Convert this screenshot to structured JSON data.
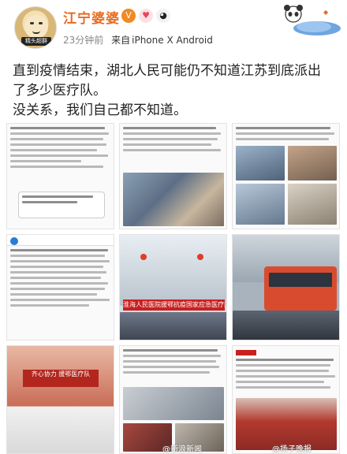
{
  "post": {
    "username": "江宁婆婆",
    "time_ago": "23分钟前",
    "source_prefix": "来自",
    "source_device": "iPhone X Android",
    "avatar_caption": "精头超群",
    "text_line1": "直到疫情结束，湖北人民可能仍不知道江苏到底派出",
    "text_line2": "了多少医疗队。",
    "text_line3": "没关系，我们自己都不知道。"
  },
  "images": {
    "banner_text": "淮海人民医院援鄂抗疫国家应急医疗队",
    "poster_text": "齐心协力 援鄂医疗队",
    "watermark1": "@新浪新闻",
    "watermark2": "@扬子晚报"
  },
  "colors": {
    "accent": "#e86b1f",
    "banner_red": "#c9201f"
  }
}
